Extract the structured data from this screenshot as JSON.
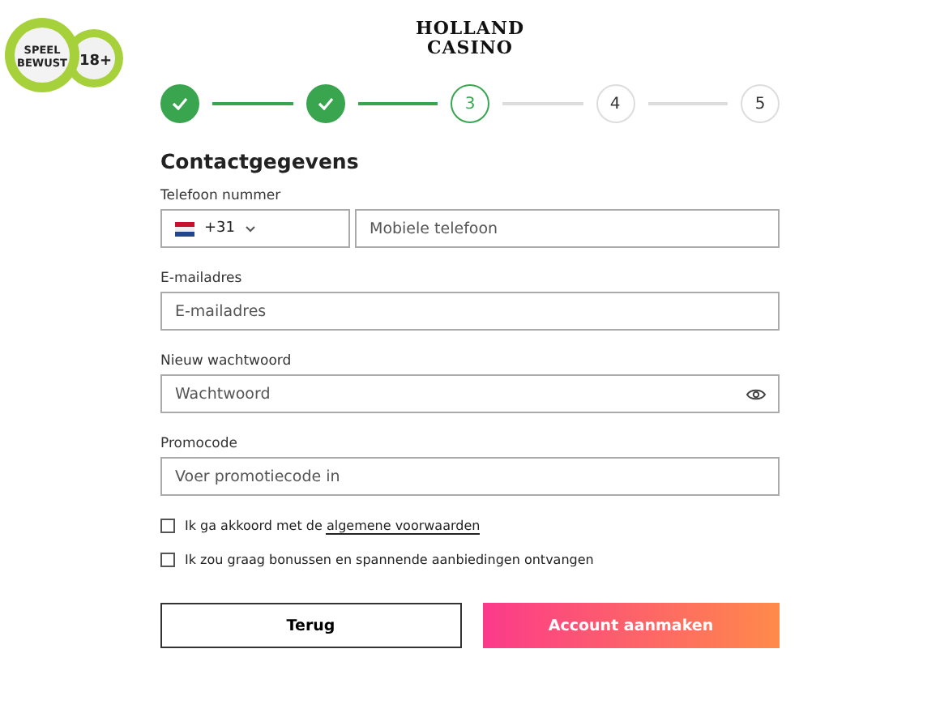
{
  "badge": {
    "line1": "SPEEL",
    "line2": "BEWUST",
    "age": "18+"
  },
  "logo": {
    "line1": "HOLLAND",
    "line2": "CASINO"
  },
  "steps": [
    {
      "done": true,
      "selected": false
    },
    {
      "done": true,
      "selected": false
    },
    {
      "label": "3",
      "done": false,
      "selected": true
    },
    {
      "label": "4",
      "done": false,
      "selected": false
    },
    {
      "label": "5",
      "done": false,
      "selected": false
    }
  ],
  "heading": "Contactgegevens",
  "phone": {
    "label": "Telefoon nummer",
    "code": "+31",
    "placeholder": "Mobiele telefoon"
  },
  "fields": [
    {
      "label": "E-mailadres",
      "placeholder": "E-mailadres",
      "kind": "text"
    },
    {
      "label": "Nieuw wachtwoord",
      "placeholder": "Wachtwoord",
      "kind": "password"
    },
    {
      "label": "Promocode",
      "placeholder": "Voer promotiecode in",
      "kind": "text"
    }
  ],
  "checkboxes": [
    {
      "text": "Ik ga akkoord met de ",
      "link": "algemene voorwaarden",
      "checked": false
    },
    {
      "text": "Ik zou graag bonussen en spannende aanbiedingen ontvangen",
      "checked": false
    }
  ],
  "buttons": {
    "back": "Terug",
    "submit": "Account aanmaken"
  }
}
